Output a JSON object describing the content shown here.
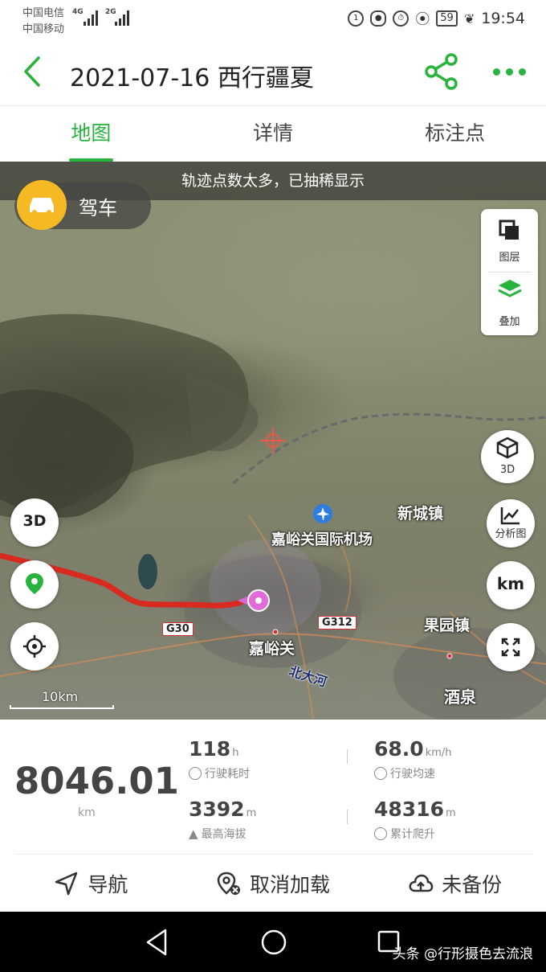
{
  "status_bar": {
    "carrier1": "中国电信",
    "carrier2": "中国移动",
    "sig1": "4G",
    "sig2": "2G",
    "battery": "59",
    "time": "19:54"
  },
  "header": {
    "title": "2021-07-16 西行疆夏",
    "accent_color": "#27b33c"
  },
  "tabs": [
    {
      "label": "地图",
      "active": true
    },
    {
      "label": "详情",
      "active": false
    },
    {
      "label": "标注点",
      "active": false
    }
  ],
  "map": {
    "notice": "轨迹点数太多，已抽稀显示",
    "mode": "驾车",
    "panel": {
      "layers": "图层",
      "overlay": "叠加"
    },
    "buttons": {
      "threed": "3D",
      "analysis": "分析图",
      "units": "km"
    },
    "left_buttons": {
      "threed": "3D"
    },
    "scale": "10km",
    "labels": {
      "airport": "嘉峪关国际机场",
      "town1": "新城镇",
      "town2": "果园镇",
      "city1": "嘉峪关",
      "city2": "酒泉",
      "river": "北大河",
      "road1": "G30",
      "road2": "G312"
    }
  },
  "stats": {
    "total_distance": "8046.01",
    "total_unit": "km",
    "duration": {
      "value": "118",
      "unit": "h",
      "label": "行驶耗时"
    },
    "avg_speed": {
      "value": "68.0",
      "unit": "km/h",
      "label": "行驶均速"
    },
    "max_alt": {
      "value": "3392",
      "unit": "m",
      "label": "最高海拔"
    },
    "climb": {
      "value": "48316",
      "unit": "m",
      "label": "累计爬升"
    }
  },
  "actions": [
    {
      "label": "导航"
    },
    {
      "label": "取消加载"
    },
    {
      "label": "未备份"
    }
  ],
  "watermark": "头条 @行形摄色去流浪"
}
